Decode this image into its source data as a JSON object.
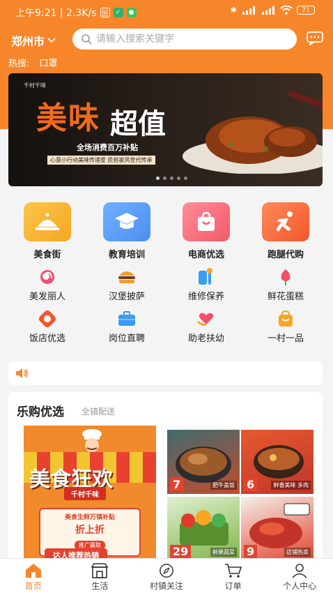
{
  "status_bar": {
    "time_speed": "上午9:21 | 2.3K/s",
    "battery": "71"
  },
  "header": {
    "city": "郑州市",
    "search_placeholder": "请输入搜索关键字"
  },
  "hot_search": {
    "label": "热搜:",
    "items": [
      "口罩"
    ]
  },
  "banner": {
    "brand": "千村千味",
    "title_main": "美味",
    "title_sub": "超值",
    "line1": "全场消费百万补贴",
    "line2": "心意小行动美味传递爱 民俗家风世代传承",
    "slides": 5,
    "active_slide": 1
  },
  "categories_main": [
    {
      "label": "美食街",
      "icon": "food-cloche-icon",
      "color": "#f6a623"
    },
    {
      "label": "教育培训",
      "icon": "graduation-cap-icon",
      "color": "#4c8ff0"
    },
    {
      "label": "电商优选",
      "icon": "shopping-bag-icon",
      "color": "#f25b6a"
    },
    {
      "label": "跑腿代购",
      "icon": "runner-icon",
      "color": "#f2572c"
    }
  ],
  "categories_sub": [
    {
      "label": "美发丽人",
      "icon": "hair-salon-icon",
      "color": "#f0506e"
    },
    {
      "label": "汉堡披萨",
      "icon": "burger-icon",
      "color": "#f39a2b"
    },
    {
      "label": "维修保养",
      "icon": "repair-tools-icon",
      "color": "#3a9cf2"
    },
    {
      "label": "鲜花蛋糕",
      "icon": "flower-icon",
      "color": "#f0506e"
    },
    {
      "label": "饭店优选",
      "icon": "restaurant-badge-icon",
      "color": "#f2572c"
    },
    {
      "label": "岗位直聘",
      "icon": "briefcase-icon",
      "color": "#3a9cf2"
    },
    {
      "label": "助老扶幼",
      "icon": "heart-hands-icon",
      "color": "#f0506e"
    },
    {
      "label": "一村一品",
      "icon": "gift-bag-icon",
      "color": "#f6a623"
    }
  ],
  "notice": {
    "icon": "speaker-icon"
  },
  "section": {
    "title": "乐购优选",
    "subtitle": "全镇配送",
    "promo": {
      "title": "美食狂欢",
      "ribbon": "千村千味",
      "card_line1": "美食生鲜万镇补贴",
      "card_line2": "折上折",
      "card_tag": "推广赢取",
      "card_btn": "达人推荐热销"
    },
    "tiles": [
      {
        "num": "7",
        "label": "肥牛盖饭",
        "color": "#c44c2c"
      },
      {
        "num": "6",
        "label": "鲜香美味 多肉",
        "color": "#d9532e"
      },
      {
        "num": "29",
        "label": "鲜果蔬菜",
        "color": "#7fb447"
      },
      {
        "num": "9",
        "label": "店铺热卖",
        "color": "#c2342a"
      }
    ]
  },
  "tabbar": [
    {
      "label": "首页",
      "icon": "home-icon",
      "active": true
    },
    {
      "label": "生活",
      "icon": "store-icon",
      "active": false
    },
    {
      "label": "村镇关注",
      "icon": "compass-icon",
      "active": false
    },
    {
      "label": "订单",
      "icon": "cart-icon",
      "active": false
    },
    {
      "label": "个人中心",
      "icon": "user-icon",
      "active": false
    }
  ]
}
